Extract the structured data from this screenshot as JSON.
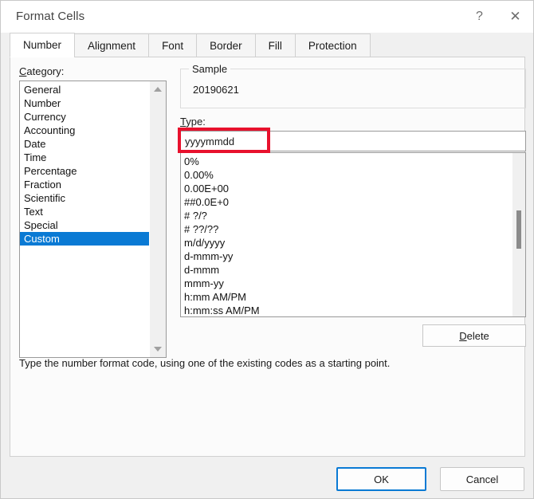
{
  "window": {
    "title": "Format Cells",
    "help_icon": "question-mark-icon",
    "close_icon": "close-x-icon",
    "help_glyph": "?",
    "close_glyph": "✕"
  },
  "tabs": [
    {
      "label": "Number",
      "active": true
    },
    {
      "label": "Alignment",
      "active": false
    },
    {
      "label": "Font",
      "active": false
    },
    {
      "label": "Border",
      "active": false
    },
    {
      "label": "Fill",
      "active": false
    },
    {
      "label": "Protection",
      "active": false
    }
  ],
  "category": {
    "label": "Category:",
    "accelerator": "C",
    "items": [
      "General",
      "Number",
      "Currency",
      "Accounting",
      "Date",
      "Time",
      "Percentage",
      "Fraction",
      "Scientific",
      "Text",
      "Special",
      "Custom"
    ],
    "selected": "Custom",
    "scroll_up_icon": "triangle-up-icon",
    "scroll_down_icon": "triangle-down-icon"
  },
  "sample": {
    "legend": "Sample",
    "value": "20190621"
  },
  "type": {
    "label": "Type:",
    "accelerator": "T",
    "value": "yyyymmdd",
    "placeholder": "",
    "annotation_color": "#e8112d",
    "items": [
      "0%",
      "0.00%",
      "0.00E+00",
      "##0.0E+0",
      "# ?/?",
      "# ??/??",
      "m/d/yyyy",
      "d-mmm-yy",
      "d-mmm",
      "mmm-yy",
      "h:mm AM/PM",
      "h:mm:ss AM/PM"
    ]
  },
  "delete_button": {
    "label": "Delete",
    "accelerator": "D"
  },
  "description": "Type the number format code, using one of the existing codes as a starting point.",
  "footer": {
    "ok_label": "OK",
    "cancel_label": "Cancel"
  },
  "colors": {
    "selection_blue": "#0a7ad4",
    "annotation_red": "#e8112d",
    "dialog_background": "#f0f0f0",
    "panel_background": "#fbfbfb"
  }
}
